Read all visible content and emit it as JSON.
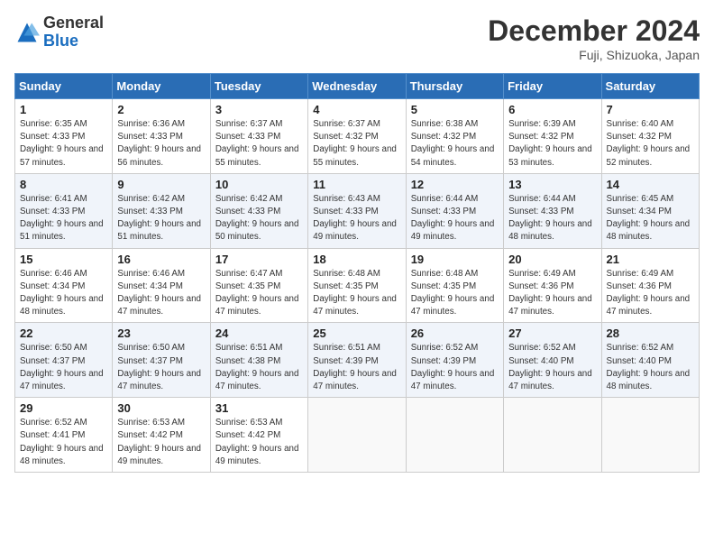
{
  "header": {
    "logo_general": "General",
    "logo_blue": "Blue",
    "month": "December 2024",
    "location": "Fuji, Shizuoka, Japan"
  },
  "days_of_week": [
    "Sunday",
    "Monday",
    "Tuesday",
    "Wednesday",
    "Thursday",
    "Friday",
    "Saturday"
  ],
  "weeks": [
    [
      {
        "day": "1",
        "sunrise": "6:35 AM",
        "sunset": "4:33 PM",
        "daylight": "9 hours and 57 minutes."
      },
      {
        "day": "2",
        "sunrise": "6:36 AM",
        "sunset": "4:33 PM",
        "daylight": "9 hours and 56 minutes."
      },
      {
        "day": "3",
        "sunrise": "6:37 AM",
        "sunset": "4:33 PM",
        "daylight": "9 hours and 55 minutes."
      },
      {
        "day": "4",
        "sunrise": "6:37 AM",
        "sunset": "4:32 PM",
        "daylight": "9 hours and 55 minutes."
      },
      {
        "day": "5",
        "sunrise": "6:38 AM",
        "sunset": "4:32 PM",
        "daylight": "9 hours and 54 minutes."
      },
      {
        "day": "6",
        "sunrise": "6:39 AM",
        "sunset": "4:32 PM",
        "daylight": "9 hours and 53 minutes."
      },
      {
        "day": "7",
        "sunrise": "6:40 AM",
        "sunset": "4:32 PM",
        "daylight": "9 hours and 52 minutes."
      }
    ],
    [
      {
        "day": "8",
        "sunrise": "6:41 AM",
        "sunset": "4:33 PM",
        "daylight": "9 hours and 51 minutes."
      },
      {
        "day": "9",
        "sunrise": "6:42 AM",
        "sunset": "4:33 PM",
        "daylight": "9 hours and 51 minutes."
      },
      {
        "day": "10",
        "sunrise": "6:42 AM",
        "sunset": "4:33 PM",
        "daylight": "9 hours and 50 minutes."
      },
      {
        "day": "11",
        "sunrise": "6:43 AM",
        "sunset": "4:33 PM",
        "daylight": "9 hours and 49 minutes."
      },
      {
        "day": "12",
        "sunrise": "6:44 AM",
        "sunset": "4:33 PM",
        "daylight": "9 hours and 49 minutes."
      },
      {
        "day": "13",
        "sunrise": "6:44 AM",
        "sunset": "4:33 PM",
        "daylight": "9 hours and 48 minutes."
      },
      {
        "day": "14",
        "sunrise": "6:45 AM",
        "sunset": "4:34 PM",
        "daylight": "9 hours and 48 minutes."
      }
    ],
    [
      {
        "day": "15",
        "sunrise": "6:46 AM",
        "sunset": "4:34 PM",
        "daylight": "9 hours and 48 minutes."
      },
      {
        "day": "16",
        "sunrise": "6:46 AM",
        "sunset": "4:34 PM",
        "daylight": "9 hours and 47 minutes."
      },
      {
        "day": "17",
        "sunrise": "6:47 AM",
        "sunset": "4:35 PM",
        "daylight": "9 hours and 47 minutes."
      },
      {
        "day": "18",
        "sunrise": "6:48 AM",
        "sunset": "4:35 PM",
        "daylight": "9 hours and 47 minutes."
      },
      {
        "day": "19",
        "sunrise": "6:48 AM",
        "sunset": "4:35 PM",
        "daylight": "9 hours and 47 minutes."
      },
      {
        "day": "20",
        "sunrise": "6:49 AM",
        "sunset": "4:36 PM",
        "daylight": "9 hours and 47 minutes."
      },
      {
        "day": "21",
        "sunrise": "6:49 AM",
        "sunset": "4:36 PM",
        "daylight": "9 hours and 47 minutes."
      }
    ],
    [
      {
        "day": "22",
        "sunrise": "6:50 AM",
        "sunset": "4:37 PM",
        "daylight": "9 hours and 47 minutes."
      },
      {
        "day": "23",
        "sunrise": "6:50 AM",
        "sunset": "4:37 PM",
        "daylight": "9 hours and 47 minutes."
      },
      {
        "day": "24",
        "sunrise": "6:51 AM",
        "sunset": "4:38 PM",
        "daylight": "9 hours and 47 minutes."
      },
      {
        "day": "25",
        "sunrise": "6:51 AM",
        "sunset": "4:39 PM",
        "daylight": "9 hours and 47 minutes."
      },
      {
        "day": "26",
        "sunrise": "6:52 AM",
        "sunset": "4:39 PM",
        "daylight": "9 hours and 47 minutes."
      },
      {
        "day": "27",
        "sunrise": "6:52 AM",
        "sunset": "4:40 PM",
        "daylight": "9 hours and 47 minutes."
      },
      {
        "day": "28",
        "sunrise": "6:52 AM",
        "sunset": "4:40 PM",
        "daylight": "9 hours and 48 minutes."
      }
    ],
    [
      {
        "day": "29",
        "sunrise": "6:52 AM",
        "sunset": "4:41 PM",
        "daylight": "9 hours and 48 minutes."
      },
      {
        "day": "30",
        "sunrise": "6:53 AM",
        "sunset": "4:42 PM",
        "daylight": "9 hours and 49 minutes."
      },
      {
        "day": "31",
        "sunrise": "6:53 AM",
        "sunset": "4:42 PM",
        "daylight": "9 hours and 49 minutes."
      },
      null,
      null,
      null,
      null
    ]
  ]
}
